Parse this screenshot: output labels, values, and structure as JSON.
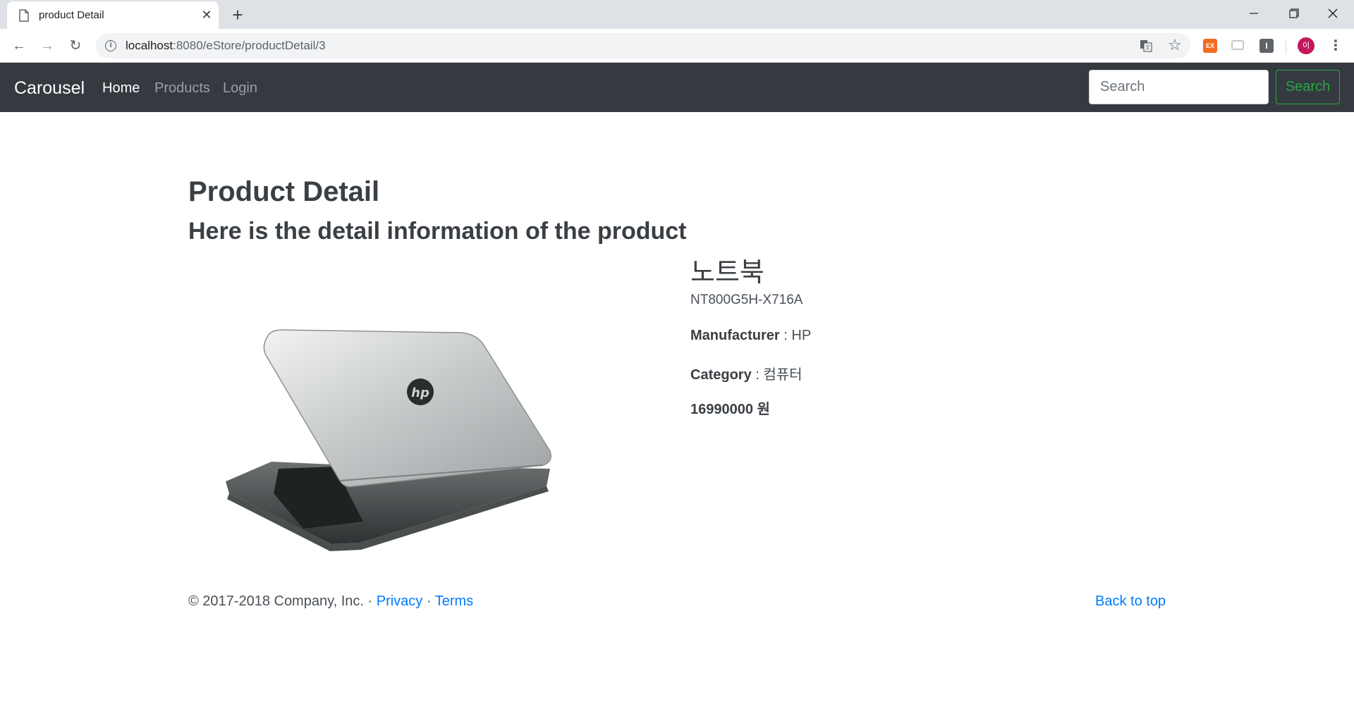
{
  "browser": {
    "tab_title": "product Detail",
    "url_host": "localhost",
    "url_rest": ":8080/eStore/productDetail/3",
    "avatar_initial": "이",
    "ext_ex_label": "EX",
    "ext_dark_label": "I"
  },
  "navbar": {
    "brand": "Carousel",
    "links": [
      {
        "label": "Home",
        "active": true
      },
      {
        "label": "Products",
        "active": false
      },
      {
        "label": "Login",
        "active": false
      }
    ],
    "search_placeholder": "Search",
    "search_button": "Search",
    "accent_color": "#28a745",
    "background": "#343a40"
  },
  "page": {
    "title": "Product Detail",
    "subtitle": "Here is the detail information of the product"
  },
  "product": {
    "name": "노트북",
    "description": "NT800G5H-X716A",
    "manufacturer_label": "Manufacturer",
    "manufacturer": "HP",
    "category_label": "Category",
    "category": "컴퓨터",
    "price": "16990000 원",
    "image_alt": "laptop-image"
  },
  "footer": {
    "copyright": "© 2017-2018 Company, Inc. · ",
    "privacy": "Privacy",
    "separator": " · ",
    "terms": "Terms",
    "back_to_top": "Back to top",
    "link_color": "#007bff"
  }
}
